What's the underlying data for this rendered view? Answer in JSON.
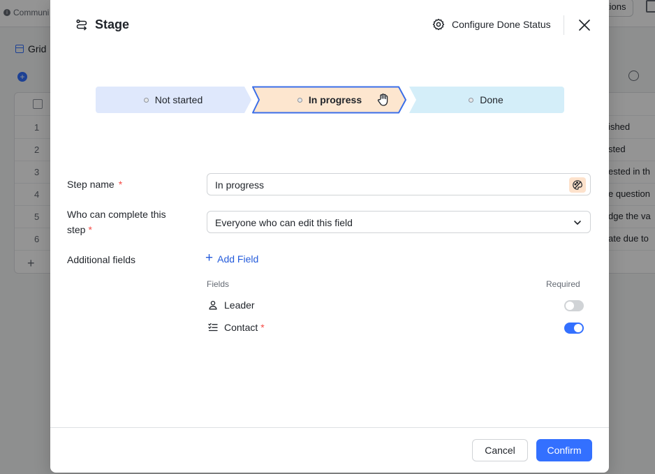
{
  "background": {
    "community_label": "Communi",
    "top_button_label": "tions",
    "view_label": "Grid",
    "rows": [
      {
        "num": "1",
        "cell": "ished"
      },
      {
        "num": "2",
        "cell": "sted"
      },
      {
        "num": "3",
        "cell": "ested in th"
      },
      {
        "num": "4",
        "cell": "e question"
      },
      {
        "num": "5",
        "cell": "dge the va"
      },
      {
        "num": "6",
        "cell": "ate due to"
      }
    ]
  },
  "modal": {
    "title": "Stage",
    "configure_label": "Configure Done Status",
    "stages": [
      {
        "label": "Not started",
        "color": "#dfe8fc"
      },
      {
        "label": "In progress",
        "color": "#fde6cf",
        "selected": true,
        "border": "#3a6ee8"
      },
      {
        "label": "Done",
        "color": "#d4eef9"
      }
    ],
    "form": {
      "step_name_label": "Step name",
      "step_name_value": "In progress",
      "who_label_line1": "Who can complete this",
      "who_label_line2": "step",
      "who_value": "Everyone who can edit this field",
      "additional_label": "Additional fields",
      "add_field_label": "Add Field",
      "fields_header": "Fields",
      "required_header": "Required",
      "required_mark": "*",
      "fields": [
        {
          "name": "Leader",
          "icon": "person-icon",
          "required": false
        },
        {
          "name": "Contact",
          "icon": "checklist-icon",
          "required": true
        }
      ]
    },
    "footer": {
      "cancel_label": "Cancel",
      "confirm_label": "Confirm"
    }
  },
  "colors": {
    "accent": "#3370ff",
    "required": "#f54a45",
    "link": "#245bdb"
  }
}
